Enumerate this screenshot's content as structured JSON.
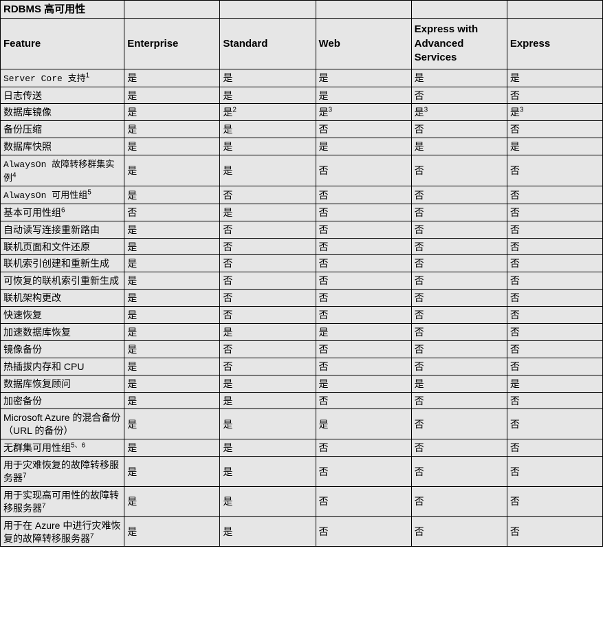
{
  "title": "RDBMS 高可用性",
  "columns": [
    "Feature",
    "Enterprise",
    "Standard",
    "Web",
    "Express with Advanced Services",
    "Express"
  ],
  "rows": [
    {
      "feature_parts": [
        {
          "t": "Server Core 支持",
          "mono": true
        },
        {
          "t": "1",
          "sup": true
        }
      ],
      "vals": [
        "是",
        "是",
        "是",
        "是",
        "是"
      ]
    },
    {
      "feature_parts": [
        {
          "t": "日志传送"
        }
      ],
      "vals": [
        "是",
        "是",
        "是",
        "否",
        "否"
      ]
    },
    {
      "feature_parts": [
        {
          "t": "数据库镜像"
        }
      ],
      "vals_rich": [
        [
          {
            "t": "是"
          }
        ],
        [
          {
            "t": "是"
          },
          {
            "t": "2",
            "sup": true
          }
        ],
        [
          {
            "t": "是"
          },
          {
            "t": "3",
            "sup": true
          }
        ],
        [
          {
            "t": "是"
          },
          {
            "t": "3",
            "sup": true
          }
        ],
        [
          {
            "t": "是"
          },
          {
            "t": "3",
            "sup": true
          }
        ]
      ]
    },
    {
      "feature_parts": [
        {
          "t": "备份压缩"
        }
      ],
      "vals": [
        "是",
        "是",
        "否",
        "否",
        "否"
      ]
    },
    {
      "feature_parts": [
        {
          "t": "数据库快照"
        }
      ],
      "vals": [
        "是",
        "是",
        "是",
        "是",
        "是"
      ]
    },
    {
      "feature_parts": [
        {
          "t": "AlwaysOn 故障转移群集实例",
          "mono": true
        },
        {
          "t": "4",
          "sup": true
        }
      ],
      "vals": [
        "是",
        "是",
        "否",
        "否",
        "否"
      ]
    },
    {
      "feature_parts": [
        {
          "t": "AlwaysOn 可用性组",
          "mono": true
        },
        {
          "t": "5",
          "sup": true
        }
      ],
      "vals": [
        "是",
        "否",
        "否",
        "否",
        "否"
      ]
    },
    {
      "feature_parts": [
        {
          "t": "基本可用性组"
        },
        {
          "t": "6",
          "sup": true
        }
      ],
      "vals": [
        "否",
        "是",
        "否",
        "否",
        "否"
      ]
    },
    {
      "feature_parts": [
        {
          "t": "自动读写连接重新路由"
        }
      ],
      "vals": [
        "是",
        "否",
        "否",
        "否",
        "否"
      ]
    },
    {
      "feature_parts": [
        {
          "t": "联机页面和文件还原"
        }
      ],
      "vals": [
        "是",
        "否",
        "否",
        "否",
        "否"
      ]
    },
    {
      "feature_parts": [
        {
          "t": "联机索引创建和重新生成"
        }
      ],
      "vals": [
        "是",
        "否",
        "否",
        "否",
        "否"
      ]
    },
    {
      "feature_parts": [
        {
          "t": "可恢复的联机索引重新生成"
        }
      ],
      "vals": [
        "是",
        "否",
        "否",
        "否",
        "否"
      ]
    },
    {
      "feature_parts": [
        {
          "t": "联机架构更改"
        }
      ],
      "vals": [
        "是",
        "否",
        "否",
        "否",
        "否"
      ]
    },
    {
      "feature_parts": [
        {
          "t": "快速恢复"
        }
      ],
      "vals": [
        "是",
        "否",
        "否",
        "否",
        "否"
      ]
    },
    {
      "feature_parts": [
        {
          "t": "加速数据库恢复"
        }
      ],
      "vals": [
        "是",
        "是",
        "是",
        "否",
        "否"
      ]
    },
    {
      "feature_parts": [
        {
          "t": "镜像备份"
        }
      ],
      "vals": [
        "是",
        "否",
        "否",
        "否",
        "否"
      ]
    },
    {
      "feature_parts": [
        {
          "t": "热插拔内存和 CPU"
        }
      ],
      "vals": [
        "是",
        "否",
        "否",
        "否",
        "否"
      ]
    },
    {
      "feature_parts": [
        {
          "t": "数据库恢复顾问"
        }
      ],
      "vals": [
        "是",
        "是",
        "是",
        "是",
        "是"
      ]
    },
    {
      "feature_parts": [
        {
          "t": "加密备份"
        }
      ],
      "vals": [
        "是",
        "是",
        "否",
        "否",
        "否"
      ]
    },
    {
      "feature_parts": [
        {
          "t": "Microsoft Azure 的混合备份（URL 的备份）"
        }
      ],
      "vals": [
        "是",
        "是",
        "是",
        "否",
        "否"
      ]
    },
    {
      "feature_parts": [
        {
          "t": "无群集可用性组"
        },
        {
          "t": "5、6",
          "sup": true
        }
      ],
      "vals": [
        "是",
        "是",
        "否",
        "否",
        "否"
      ]
    },
    {
      "feature_parts": [
        {
          "t": "用于灾难恢复的故障转移服务器"
        },
        {
          "t": "7",
          "sup": true
        }
      ],
      "vals": [
        "是",
        "是",
        "否",
        "否",
        "否"
      ]
    },
    {
      "feature_parts": [
        {
          "t": "用于实现高可用性的故障转移服务器"
        },
        {
          "t": "7",
          "sup": true
        }
      ],
      "vals": [
        "是",
        "是",
        "否",
        "否",
        "否"
      ]
    },
    {
      "feature_parts": [
        {
          "t": "用于在 Azure 中进行灾难恢复的故障转移服务器"
        },
        {
          "t": "7",
          "sup": true
        }
      ],
      "vals": [
        "是",
        "是",
        "否",
        "否",
        "否"
      ]
    }
  ]
}
